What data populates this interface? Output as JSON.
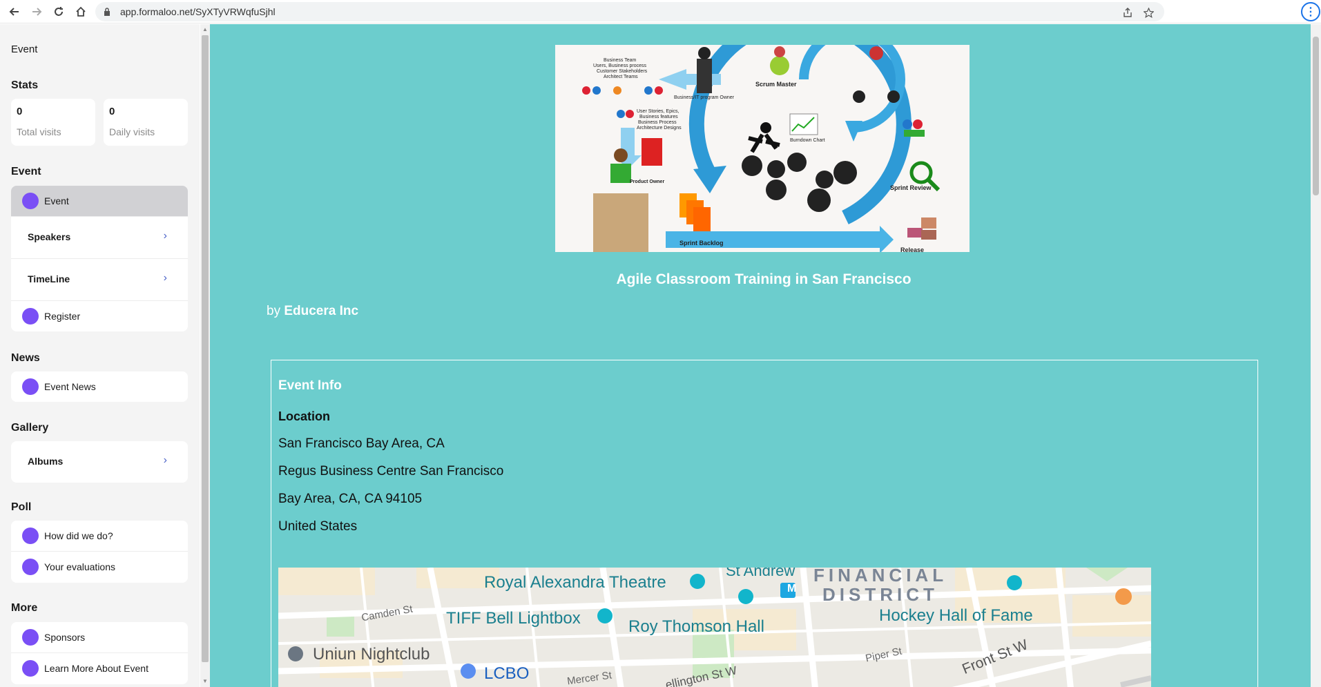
{
  "browser": {
    "url": "app.formaloo.net/SyXTyVRWqfuSjhl",
    "profile_initial": "⋮"
  },
  "sidebar": {
    "top_title": "Event",
    "stats_heading": "Stats",
    "stats": [
      {
        "value": "0",
        "label": "Total visits"
      },
      {
        "value": "0",
        "label": "Daily visits"
      }
    ],
    "event_heading": "Event",
    "event_items": [
      {
        "label": "Event"
      },
      {
        "label": "Speakers"
      },
      {
        "label": "TimeLine"
      },
      {
        "label": "Register"
      }
    ],
    "news_heading": "News",
    "news_items": [
      {
        "label": "Event News"
      }
    ],
    "gallery_heading": "Gallery",
    "gallery_items": [
      {
        "label": "Albums"
      }
    ],
    "poll_heading": "Poll",
    "poll_items": [
      {
        "label": "How did we do?"
      },
      {
        "label": "Your evaluations"
      }
    ],
    "more_heading": "More",
    "more_items": [
      {
        "label": "Sponsors"
      },
      {
        "label": "Learn More About Event"
      }
    ]
  },
  "hero_image": {
    "labels": {
      "business_team": "Business Team",
      "business_team_2": "Users, Business process",
      "business_team_3": "Customer Stakeholders",
      "business_team_4": "Architect Teams",
      "owner": "Business/IT program Owner",
      "scrum_master": "Scrum Master",
      "user_stories": "User Stories, Epics,",
      "user_stories_2": "Business features",
      "user_stories_3": "Business Process",
      "user_stories_4": "Architecture Designs",
      "burndown": "Burndown Chart",
      "product_owner": "Product Owner",
      "sprint_review": "Sprint Review",
      "sprint_backlog": "Sprint Backlog",
      "release": "Release"
    }
  },
  "event": {
    "title": "Agile Classroom Training in San Francisco",
    "by_prefix": "by",
    "organizer": "Educera Inc"
  },
  "info": {
    "title": "Event Info",
    "location_heading": "Location",
    "lines": [
      "San Francisco Bay Area, CA",
      "Regus Business Centre San Francisco",
      "Bay Area, CA, CA 94105",
      "United States"
    ]
  },
  "map": {
    "labels": {
      "royal_alexandra": "Royal Alexandra Theatre",
      "st_andrew": "St Andrew",
      "financial": "FINANCIAL",
      "district": "DISTRICT",
      "camden": "Camden St",
      "tiff": "TIFF Bell Lightbox",
      "roy_thomson": "Roy Thomson Hall",
      "hockey": "Hockey Hall of Fame",
      "uniun": "Uniun Nightclub",
      "lcbo": "LCBO",
      "mercer": "Mercer St",
      "wellington": "ellington St W",
      "piper": "Piper St",
      "front": "Front St W",
      "metro": "M"
    }
  },
  "colors": {
    "main_bg": "#6ccdcd",
    "accent_dot": "#7a4ff5",
    "chevron": "#4b63c8"
  }
}
